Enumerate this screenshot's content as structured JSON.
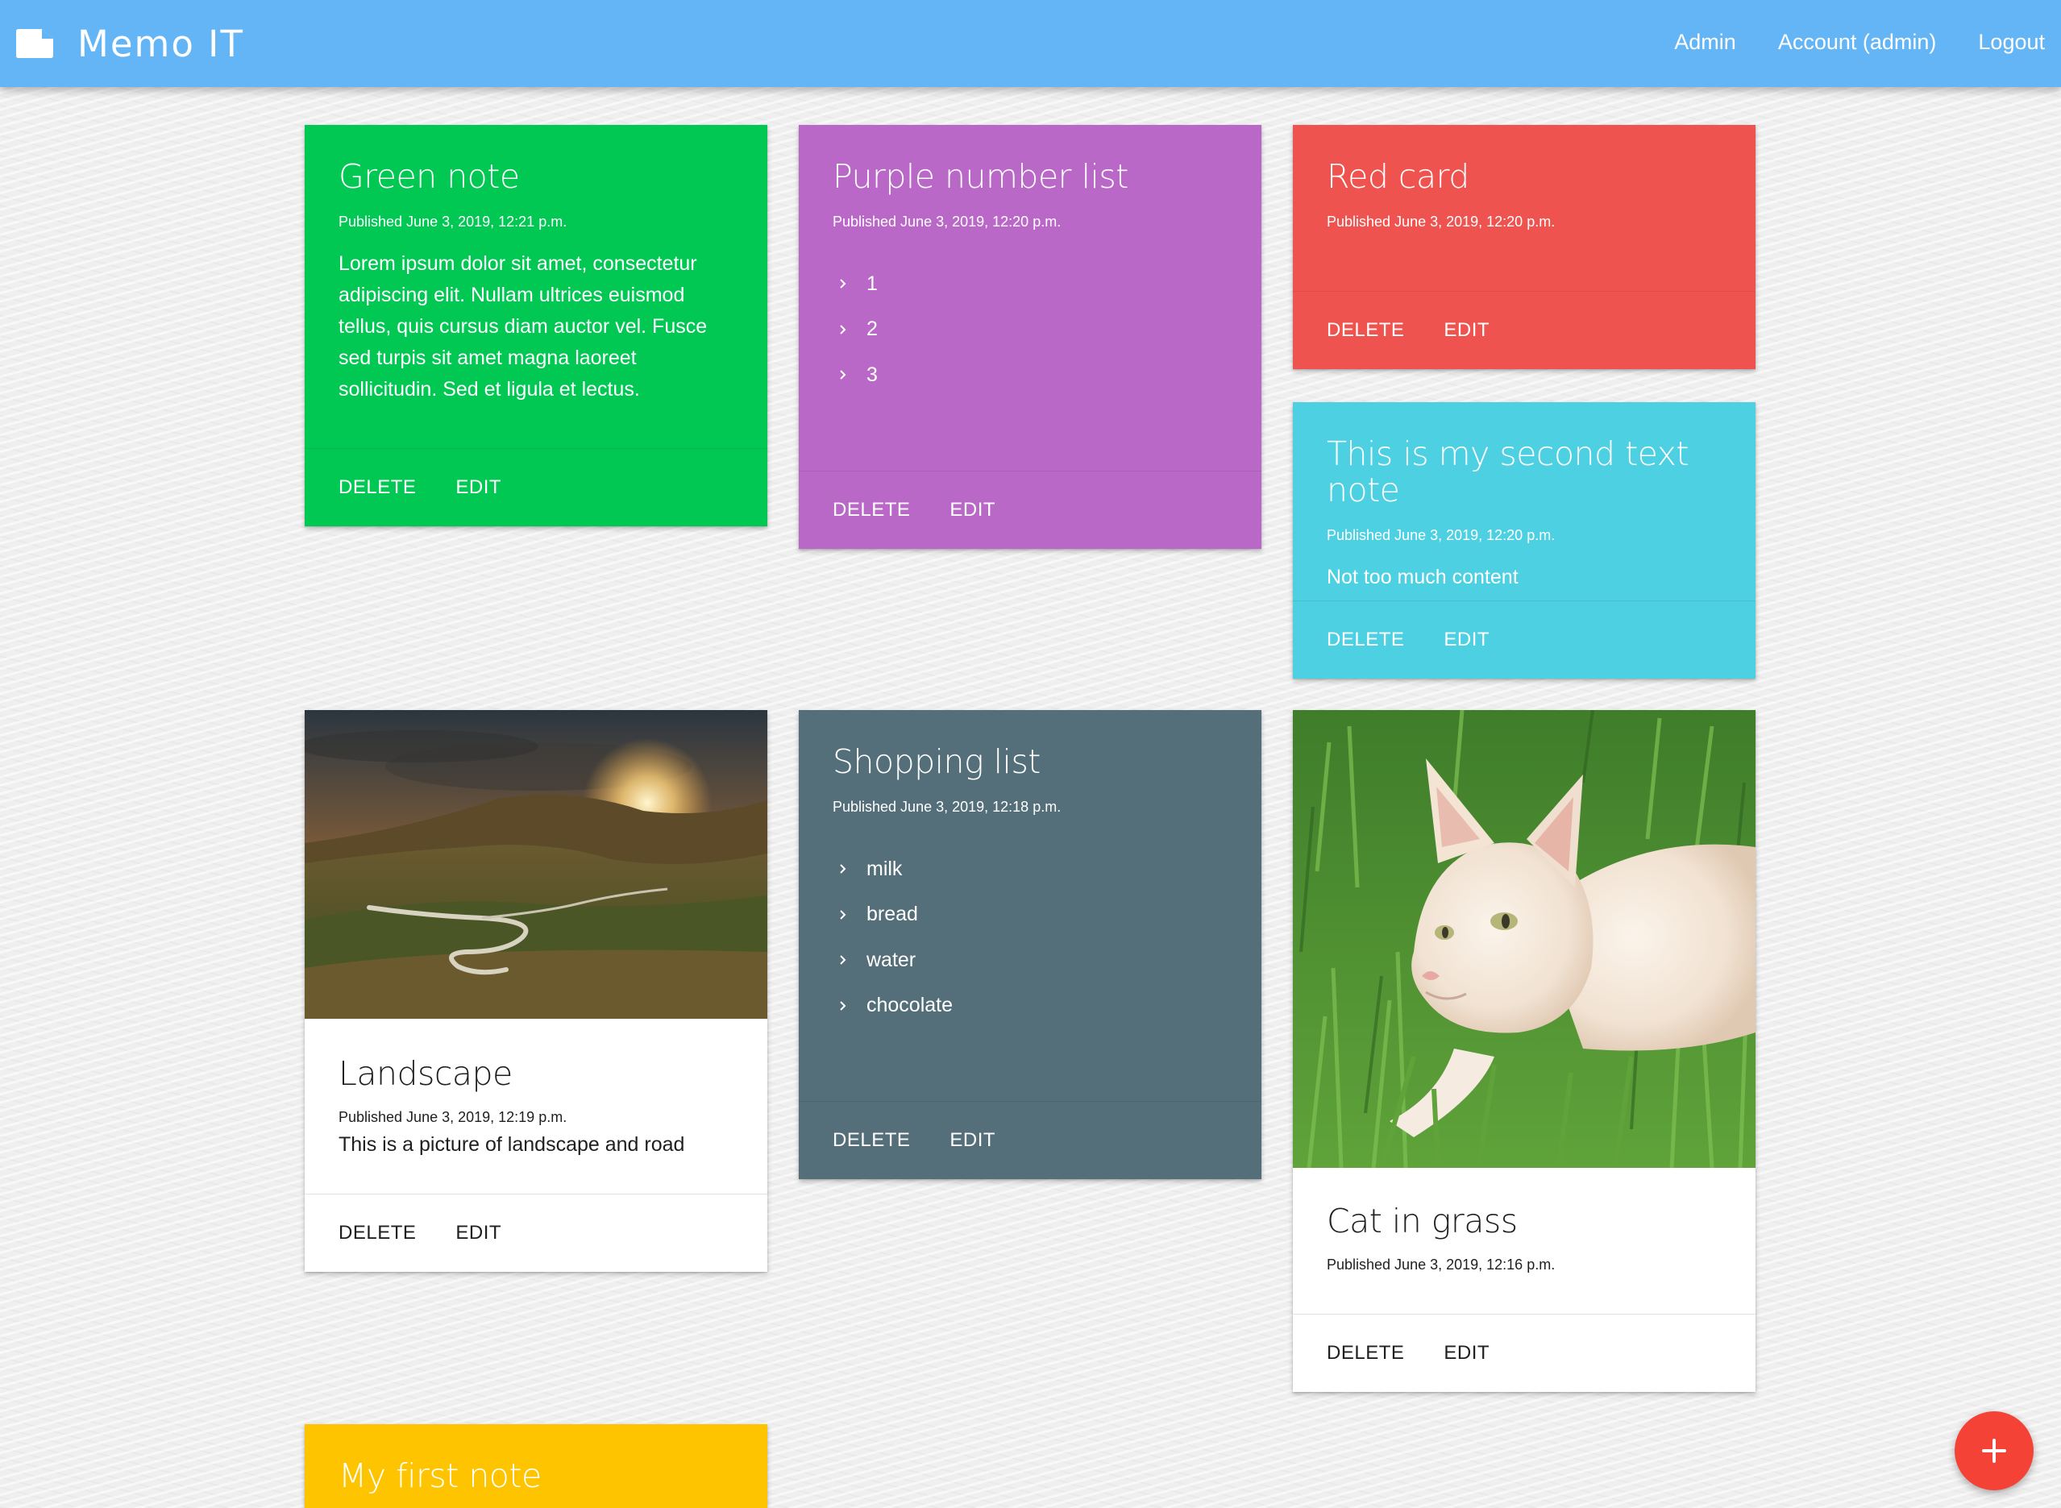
{
  "navbar": {
    "brand": "Memo IT",
    "brand_icon": "note-icon",
    "links": [
      "Admin",
      "Account (admin)",
      "Logout"
    ],
    "color": "#64b5f6"
  },
  "card_actions": {
    "delete": "DELETE",
    "edit": "EDIT"
  },
  "cards": [
    {
      "title": "Green note",
      "date": "Published June 3, 2019, 12:21 p.m.",
      "text": "Lorem ipsum dolor sit amet, consectetur adipiscing elit. Nullam ultrices euismod tellus, quis cursus diam auctor vel. Fusce sed turpis sit amet magna laoreet sollicitudin. Sed et ligula et lectus.",
      "color": "#00c853"
    },
    {
      "title": "Purple number list",
      "date": "Published June 3, 2019, 12:20 p.m.",
      "items": [
        "1",
        "2",
        "3"
      ],
      "color": "#ba68c8"
    },
    {
      "title": "Red card",
      "date": "Published June 3, 2019, 12:20 p.m.",
      "color": "#ef5350"
    },
    {
      "title": "This is my second text note",
      "date": "Published June 3, 2019, 12:20 p.m.",
      "text": "Not too much content",
      "color": "#4dd0e1"
    },
    {
      "title": "Landscape",
      "date": "Published June 3, 2019, 12:19 p.m.",
      "text": "This is a picture of landscape and road",
      "image": "landscape-photo",
      "color": "#ffffff"
    },
    {
      "title": "Shopping list",
      "date": "Published June 3, 2019, 12:18 p.m.",
      "items": [
        "milk",
        "bread",
        "water",
        "chocolate"
      ],
      "color": "#546e7a"
    },
    {
      "title": "Cat in grass",
      "date": "Published June 3, 2019, 12:16 p.m.",
      "image": "cat-photo",
      "color": "#ffffff"
    },
    {
      "title": "My first note",
      "color": "#ffc400"
    }
  ],
  "fab": {
    "icon": "plus-icon",
    "color": "#f44336"
  }
}
